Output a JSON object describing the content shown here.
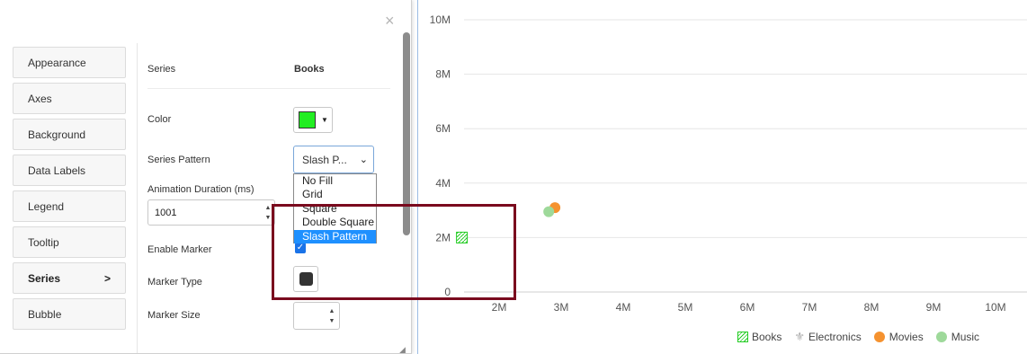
{
  "dialog": {
    "close_icon": "×",
    "tabs": [
      {
        "label": "Appearance",
        "active": false
      },
      {
        "label": "Axes",
        "active": false
      },
      {
        "label": "Background",
        "active": false
      },
      {
        "label": "Data Labels",
        "active": false
      },
      {
        "label": "Legend",
        "active": false
      },
      {
        "label": "Tooltip",
        "active": false
      },
      {
        "label": "Series",
        "active": true,
        "chevron": ">"
      },
      {
        "label": "Bubble",
        "active": false
      }
    ],
    "form": {
      "series_label": "Series",
      "series_value": "Books",
      "color_label": "Color",
      "color_value": "#22ee22",
      "pattern_label": "Series Pattern",
      "pattern_selected": "Slash P...",
      "pattern_options": [
        "No Fill",
        "Grid",
        "Square",
        "Double Square",
        "Slash Pattern"
      ],
      "pattern_highlighted": "Slash Pattern",
      "animation_label": "Animation Duration (ms)",
      "animation_value": "1001",
      "enable_marker_label": "Enable Marker",
      "enable_marker_checked": true,
      "marker_type_label": "Marker Type",
      "marker_size_label": "Marker Size",
      "marker_size_value": ""
    }
  },
  "chart_data": {
    "type": "scatter",
    "title": "",
    "xlabel": "",
    "ylabel": "",
    "x_ticks": [
      "2M",
      "3M",
      "4M",
      "5M",
      "6M",
      "7M",
      "8M",
      "9M",
      "10M"
    ],
    "y_ticks": [
      "0",
      "2M",
      "4M",
      "6M",
      "8M",
      "10M"
    ],
    "xlim": [
      1000000,
      10000000
    ],
    "ylim": [
      0,
      10000000
    ],
    "grid": true,
    "legend_position": "bottom-right",
    "series": [
      {
        "name": "Books",
        "color": "#22cc22",
        "marker": "slash-pattern-square",
        "points": [
          [
            1400000,
            2000000
          ]
        ]
      },
      {
        "name": "Electronics",
        "color": "#aaaaaa",
        "marker": "fleur",
        "points": []
      },
      {
        "name": "Movies",
        "color": "#f5922f",
        "marker": "circle",
        "points": [
          [
            2900000,
            3100000
          ]
        ]
      },
      {
        "name": "Music",
        "color": "#9ed99a",
        "marker": "circle",
        "points": [
          [
            2800000,
            2950000
          ]
        ]
      }
    ]
  }
}
